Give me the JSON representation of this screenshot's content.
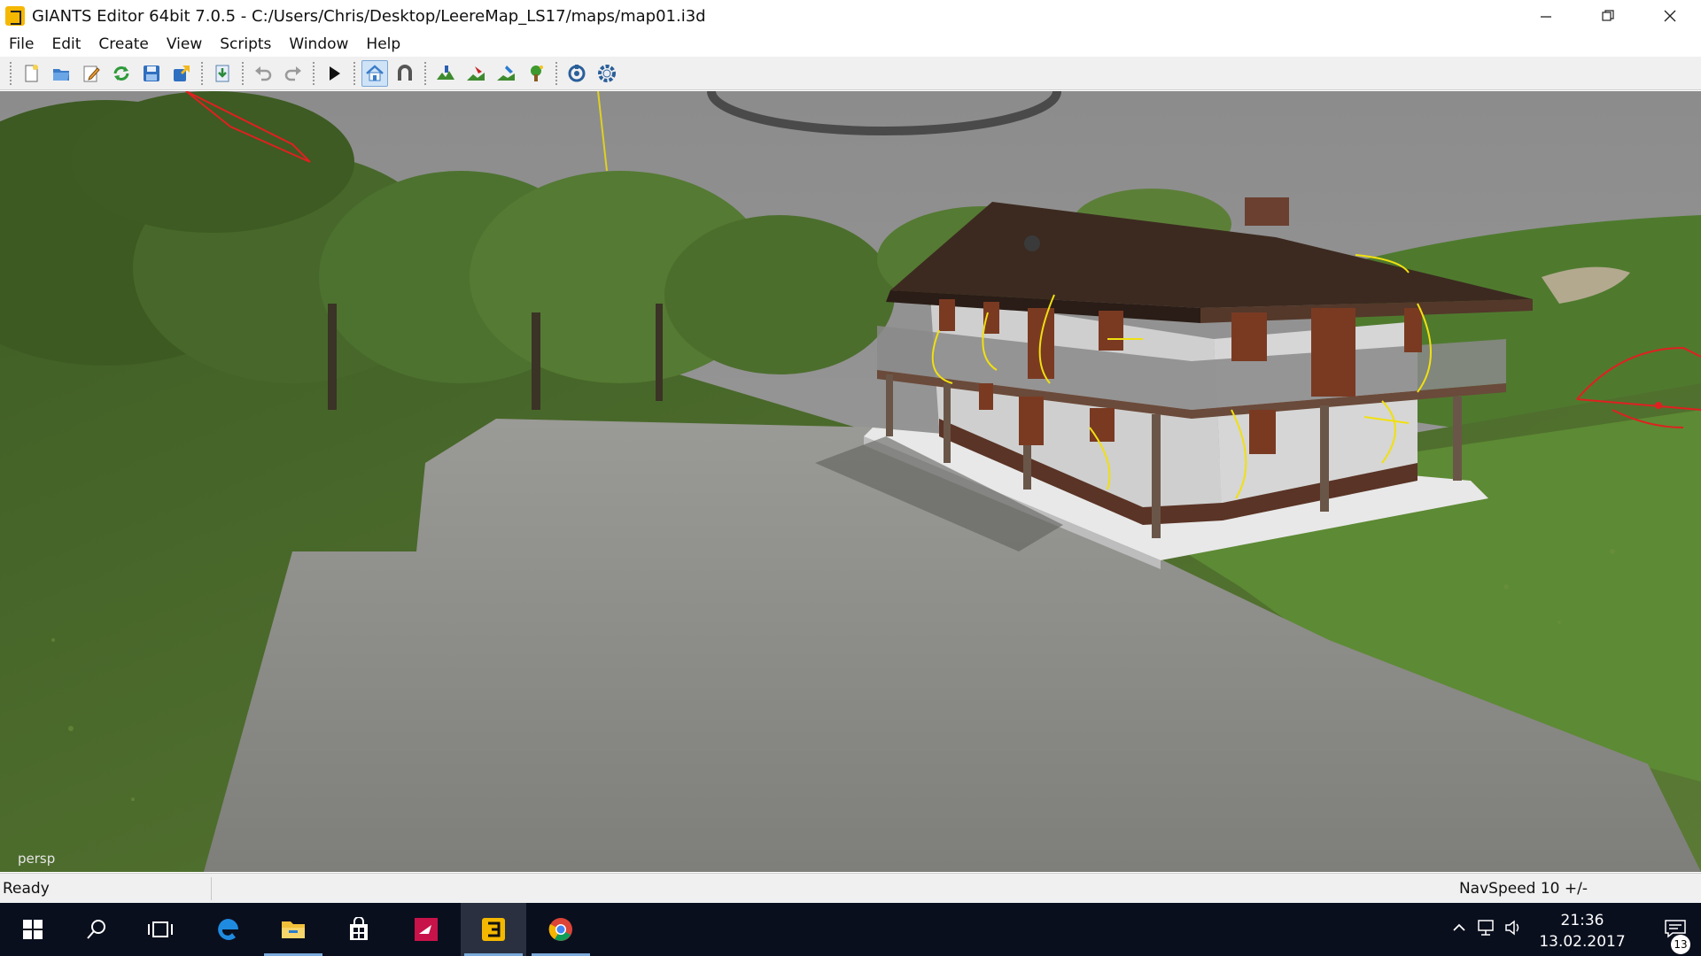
{
  "window": {
    "title": "GIANTS Editor 64bit 7.0.5 - C:/Users/Chris/Desktop/LeereMap_LS17/maps/map01.i3d",
    "minimize_icon": "minimize-icon",
    "maximize_icon": "restore-icon",
    "close_icon": "close-icon"
  },
  "menu": {
    "items": [
      "File",
      "Edit",
      "Create",
      "View",
      "Scripts",
      "Window",
      "Help"
    ]
  },
  "toolbar": {
    "buttons": [
      "new-icon",
      "open-icon",
      "edit-icon",
      "reload-icon",
      "save-icon",
      "export-icon",
      "import-icon",
      "undo-icon",
      "redo-icon",
      "play-icon",
      "home-icon",
      "magnet-icon",
      "terrain-paint-icon",
      "foliage-icon",
      "decal-icon",
      "tree-icon",
      "sync-icon",
      "settings-icon"
    ]
  },
  "viewport": {
    "camera_label": "persp"
  },
  "status": {
    "left": "Ready",
    "right": "NavSpeed 10 +/-"
  },
  "taskbar": {
    "apps": [
      "start-icon",
      "search-icon",
      "task-view-icon",
      "edge-icon",
      "file-explorer-icon",
      "store-icon",
      "paint-app-icon",
      "giants-editor-icon",
      "chrome-icon"
    ],
    "clock_time": "21:36",
    "clock_date": "13.02.2017",
    "notification_count": "13"
  },
  "colors": {
    "titlebar": "#ffffff",
    "toolbar": "#f0f0f0",
    "taskbar": "#0a0f1e",
    "sky": "#8a8a8a",
    "grass": "#4e6a2e",
    "road": "#8a8a86"
  }
}
